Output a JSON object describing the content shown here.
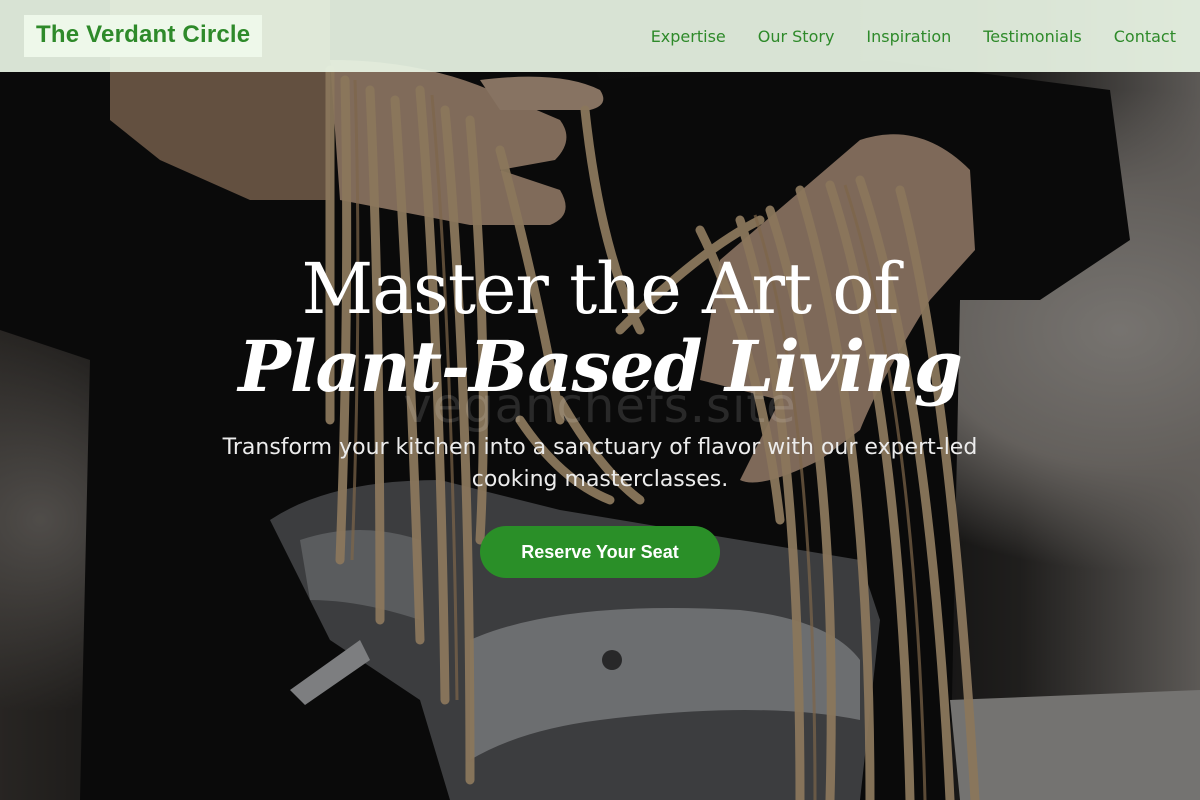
{
  "brand": {
    "name": "The Verdant Circle",
    "accent_color": "#2e8a2a"
  },
  "nav": {
    "items": [
      {
        "label": "Expertise"
      },
      {
        "label": "Our Story"
      },
      {
        "label": "Inspiration"
      },
      {
        "label": "Testimonials"
      },
      {
        "label": "Contact"
      }
    ]
  },
  "hero": {
    "title_line1": "Master the Art of",
    "title_line2": "Plant-Based Living",
    "watermark": "veganchefs.site",
    "subtitle": "Transform your kitchen into a sanctuary of flavor with our expert-led cooking masterclasses.",
    "cta_label": "Reserve Your Seat",
    "cta_color": "#2a8f28",
    "background_image": "hands-holding-fresh-pasta-over-pasta-machine"
  }
}
